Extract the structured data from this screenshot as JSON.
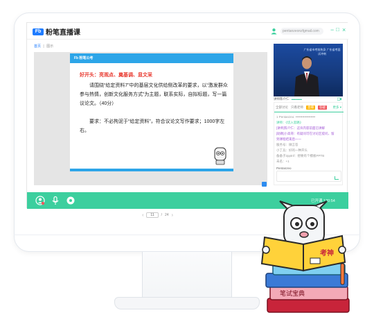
{
  "app": {
    "logo_mark": "Fb",
    "logo_name": "粉笔直播课",
    "user_email": "pentanzeonzfgmail.com",
    "window_controls": {
      "minimize": "−",
      "maximize": "□",
      "close": "×"
    }
  },
  "breadcrumb": {
    "home": "首页",
    "sep": "|",
    "current": "图示"
  },
  "slide": {
    "header": "Fb 粉笔公考",
    "title": "好开头：亮观点、奠基调、显文采",
    "paragraphs": [
      "请围绕“给定资料7”中的基层文化供给侧改革的要求，以“激发群众参与热情，创新文化服务方式”为主题，联系实际，自拟标题，写一篇议论文。（40分）",
      "要求：不必拘泥于“给定资料”，符合议论文写作要求；1000字左右。"
    ]
  },
  "pager": {
    "prev": "‹",
    "current": "11",
    "sep": "/",
    "total": "24",
    "next": "›"
  },
  "video": {
    "banner": "广东省市考前热身 广东省考面试冲刺"
  },
  "teacher": {
    "name": "讲师陈介仁",
    "status": "••••••••••••••"
  },
  "side_panel": {
    "tab_labels": [
      "全部讨论",
      "只看老师"
    ],
    "badges": [
      "直播",
      "答疑"
    ],
    "more": "更多 ▾",
    "chat_lines": [
      {
        "text": "1 Pentanzeo: ••••••••••••••••••",
        "style": "grey"
      },
      {
        "text": "讲师：《切入思路》",
        "style": "green"
      },
      {
        "text": "[讲师]陈介仁：这块内容前面已讲解",
        "style": "purple"
      },
      {
        "text": "[助教]小高哥：有疑问可在讨论区提问，留",
        "style": "purple"
      },
      {
        "text": "到课程结束后一一",
        "style": "purple"
      },
      {
        "text": "服务号：微言答",
        "style": "grey"
      },
      {
        "text": "小丁兵：好的一种开头",
        "style": "grey"
      },
      {
        "text": "备备子2pptnf：想要有个模板PPTB",
        "style": "grey"
      },
      {
        "text": "未名：+1",
        "style": "grey"
      }
    ],
    "input_label": "Pentanzeo"
  },
  "bottombar": {
    "status": "已开课 120:54"
  },
  "mascot": {
    "book_top": "考神",
    "book_bottom": "笔试宝典"
  },
  "colors": {
    "accent": "#3ccf9e",
    "brand_blue": "#1f7cff",
    "slide_blue": "#2da5e8",
    "title_red": "#e8352b"
  }
}
